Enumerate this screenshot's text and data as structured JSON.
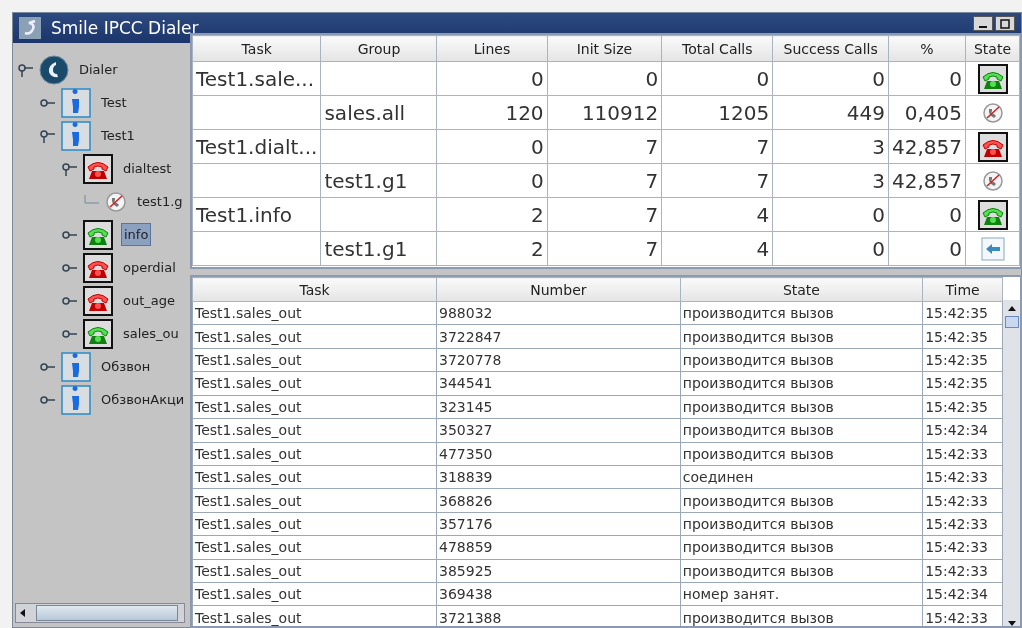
{
  "window": {
    "title": "Smile IPCC Dialer"
  },
  "tree": [
    {
      "label": "Dialer",
      "kind": "dialer",
      "expanded": true,
      "selected": false,
      "children": [
        {
          "label": "Test",
          "kind": "person",
          "expanded": false,
          "selected": false
        },
        {
          "label": "Test1",
          "kind": "person",
          "expanded": true,
          "selected": false,
          "children": [
            {
              "label": "dialtest",
              "kind": "phone-red",
              "expanded": true,
              "selected": false,
              "children": [
                {
                  "label": "test1.g",
                  "kind": "no-phone",
                  "selected": false
                }
              ]
            },
            {
              "label": "info",
              "kind": "phone-green",
              "expanded": false,
              "selected": true
            },
            {
              "label": "operdial",
              "kind": "phone-red",
              "expanded": false,
              "selected": false
            },
            {
              "label": "out_age",
              "kind": "phone-red",
              "expanded": false,
              "selected": false
            },
            {
              "label": "sales_ou",
              "kind": "phone-green",
              "expanded": false,
              "selected": false
            }
          ]
        },
        {
          "label": "Обзвон",
          "kind": "person",
          "expanded": false,
          "selected": false
        },
        {
          "label": "ОбзвонАкци",
          "kind": "person",
          "expanded": false,
          "selected": false
        }
      ]
    }
  ],
  "task_table": {
    "columns": [
      "Task",
      "Group",
      "Lines",
      "Init Size",
      "Total Calls",
      "Success Calls",
      "%",
      "State"
    ],
    "rows": [
      {
        "task": "Test1.sale...",
        "group": "",
        "lines": "0",
        "init_size": "0",
        "total_calls": "0",
        "success_calls": "0",
        "percent": "0",
        "kind": "phone-green"
      },
      {
        "task": "",
        "group": "sales.all",
        "lines": "120",
        "init_size": "110912",
        "total_calls": "1205",
        "success_calls": "449",
        "percent": "0,405",
        "kind": "no-phone"
      },
      {
        "task": "Test1.dialt...",
        "group": "",
        "lines": "0",
        "init_size": "7",
        "total_calls": "7",
        "success_calls": "3",
        "percent": "42,857",
        "kind": "phone-red"
      },
      {
        "task": "",
        "group": "test1.g1",
        "lines": "0",
        "init_size": "7",
        "total_calls": "7",
        "success_calls": "3",
        "percent": "42,857",
        "kind": "no-phone"
      },
      {
        "task": "Test1.info",
        "group": "",
        "lines": "2",
        "init_size": "7",
        "total_calls": "4",
        "success_calls": "0",
        "percent": "0",
        "kind": "phone-green"
      },
      {
        "task": "",
        "group": "test1.g1",
        "lines": "2",
        "init_size": "7",
        "total_calls": "4",
        "success_calls": "0",
        "percent": "0",
        "kind": "arrow"
      }
    ]
  },
  "call_table": {
    "columns": [
      "Task",
      "Number",
      "State",
      "Time"
    ],
    "rows": [
      [
        "Test1.sales_out",
        "988032",
        "производится вызов",
        "15:42:35"
      ],
      [
        "Test1.sales_out",
        "3722847",
        "производится вызов",
        "15:42:35"
      ],
      [
        "Test1.sales_out",
        "3720778",
        "производится вызов",
        "15:42:35"
      ],
      [
        "Test1.sales_out",
        "344541",
        "производится вызов",
        "15:42:35"
      ],
      [
        "Test1.sales_out",
        "323145",
        "производится вызов",
        "15:42:35"
      ],
      [
        "Test1.sales_out",
        "350327",
        "производится вызов",
        "15:42:34"
      ],
      [
        "Test1.sales_out",
        "477350",
        "производится вызов",
        "15:42:33"
      ],
      [
        "Test1.sales_out",
        "318839",
        "соединен",
        "15:42:33"
      ],
      [
        "Test1.sales_out",
        "368826",
        "производится вызов",
        "15:42:33"
      ],
      [
        "Test1.sales_out",
        "357176",
        "производится вызов",
        "15:42:33"
      ],
      [
        "Test1.sales_out",
        "478859",
        "производится вызов",
        "15:42:33"
      ],
      [
        "Test1.sales_out",
        "385925",
        "производится вызов",
        "15:42:33"
      ],
      [
        "Test1.sales_out",
        "369438",
        "номер занят.",
        "15:42:34"
      ],
      [
        "Test1.sales_out",
        "3721388",
        "производится вызов",
        "15:42:33"
      ]
    ]
  }
}
